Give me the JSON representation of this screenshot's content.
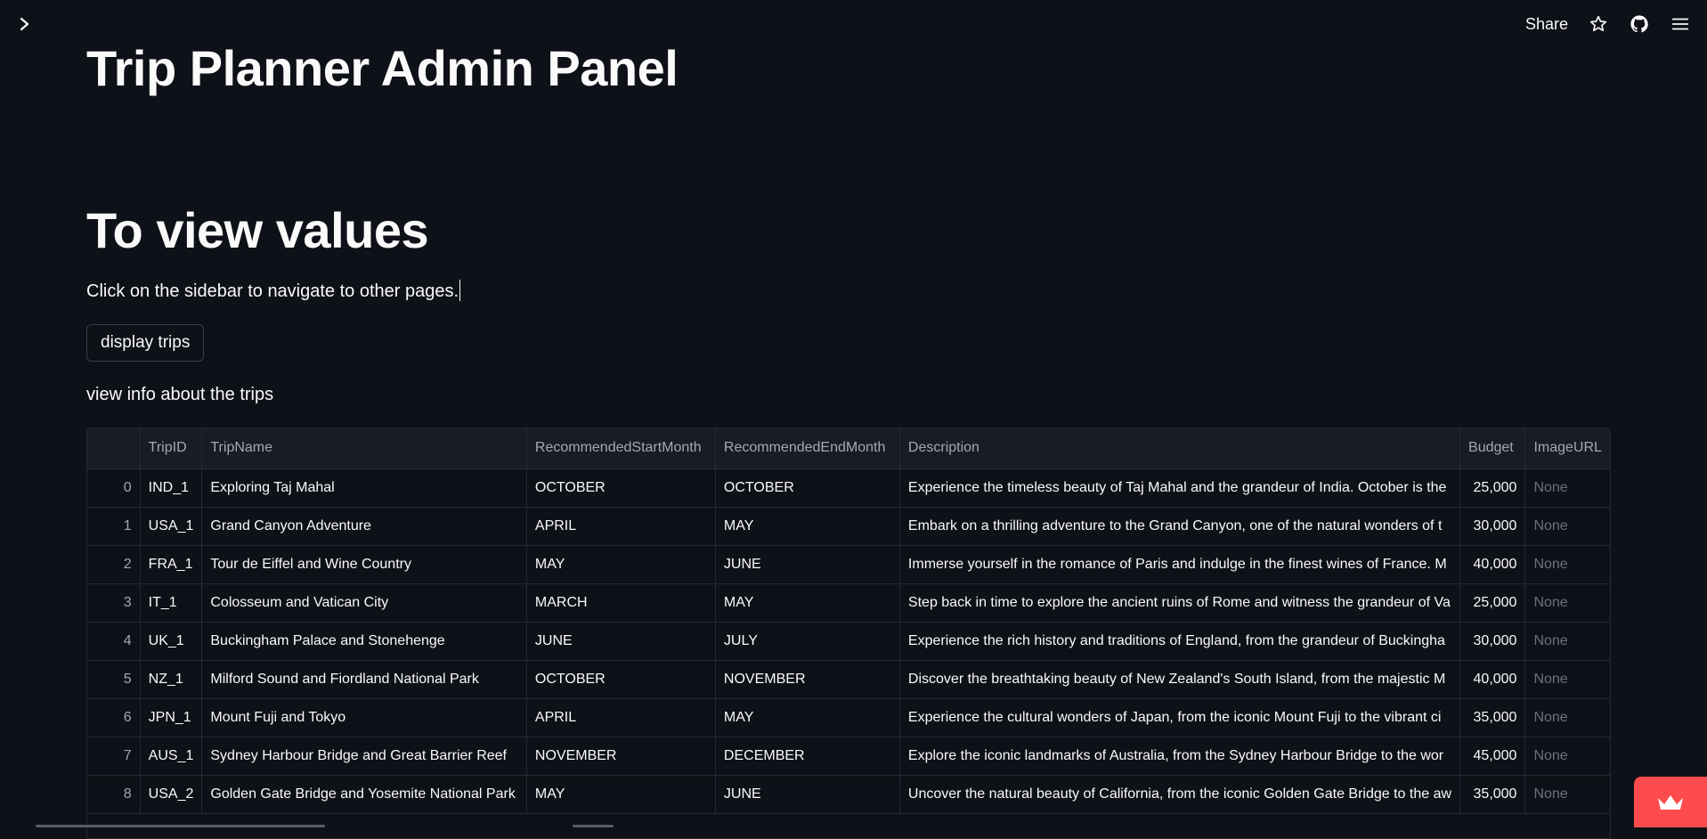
{
  "header": {
    "share_label": "Share"
  },
  "page": {
    "title": "Trip Planner Admin Panel",
    "subtitle": "To view values",
    "instruction": "Click on the sidebar to navigate to other pages.",
    "button_label": "display trips",
    "caption": "view info about the trips"
  },
  "table": {
    "columns": [
      "",
      "TripID",
      "TripName",
      "RecommendedStartMonth",
      "RecommendedEndMonth",
      "Description",
      "Budget",
      "ImageURL"
    ],
    "rows": [
      [
        "0",
        "IND_1",
        "Exploring Taj Mahal",
        "OCTOBER",
        "OCTOBER",
        "Experience the timeless beauty of Taj Mahal and the grandeur of India. October is the",
        "25,000",
        "None"
      ],
      [
        "1",
        "USA_1",
        "Grand Canyon Adventure",
        "APRIL",
        "MAY",
        "Embark on a thrilling adventure to the Grand Canyon, one of the natural wonders of t",
        "30,000",
        "None"
      ],
      [
        "2",
        "FRA_1",
        "Tour de Eiffel and Wine Country",
        "MAY",
        "JUNE",
        "Immerse yourself in the romance of Paris and indulge in the finest wines of France. M",
        "40,000",
        "None"
      ],
      [
        "3",
        "IT_1",
        "Colosseum and Vatican City",
        "MARCH",
        "MAY",
        "Step back in time to explore the ancient ruins of Rome and witness the grandeur of Va",
        "25,000",
        "None"
      ],
      [
        "4",
        "UK_1",
        "Buckingham Palace and Stonehenge",
        "JUNE",
        "JULY",
        "Experience the rich history and traditions of England, from the grandeur of Buckingha",
        "30,000",
        "None"
      ],
      [
        "5",
        "NZ_1",
        "Milford Sound and Fiordland National Park",
        "OCTOBER",
        "NOVEMBER",
        "Discover the breathtaking beauty of New Zealand's South Island, from the majestic M",
        "40,000",
        "None"
      ],
      [
        "6",
        "JPN_1",
        "Mount Fuji and Tokyo",
        "APRIL",
        "MAY",
        "Experience the cultural wonders of Japan, from the iconic Mount Fuji to the vibrant ci",
        "35,000",
        "None"
      ],
      [
        "7",
        "AUS_1",
        "Sydney Harbour Bridge and Great Barrier Reef",
        "NOVEMBER",
        "DECEMBER",
        "Explore the iconic landmarks of Australia, from the Sydney Harbour Bridge to the wor",
        "45,000",
        "None"
      ],
      [
        "8",
        "USA_2",
        "Golden Gate Bridge and Yosemite National Park",
        "MAY",
        "JUNE",
        "Uncover the natural beauty of California, from the iconic Golden Gate Bridge to the aw",
        "35,000",
        "None"
      ]
    ]
  },
  "colors": {
    "background": "#0e1117",
    "accent": "#ff4b4b",
    "muted": "#a3a8b4"
  },
  "icons": [
    "chevron-right-icon",
    "star-icon",
    "github-icon",
    "hamburger-menu-icon",
    "streamlit-crown-icon"
  ]
}
